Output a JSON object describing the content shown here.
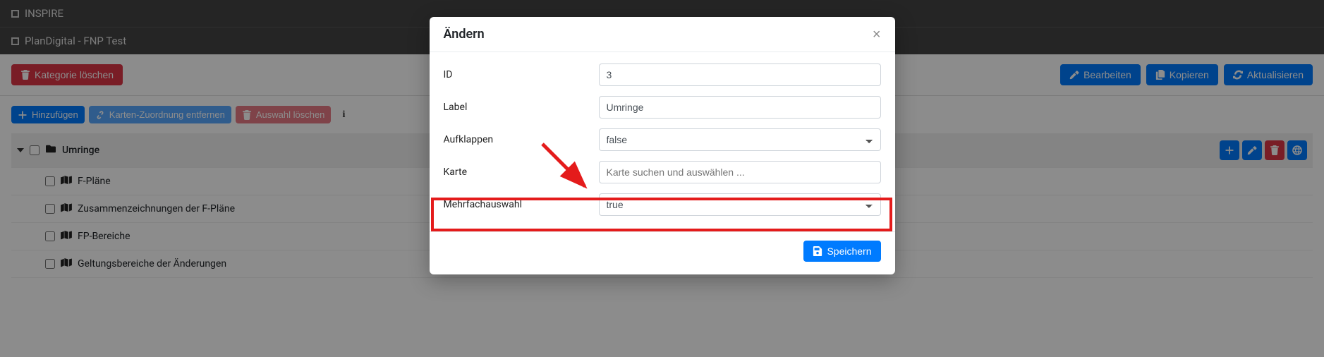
{
  "topbar": {
    "title1": "INSPIRE",
    "title2": "PlanDigital - FNP Test"
  },
  "toolbar": {
    "delete_category": "Kategorie löschen",
    "edit": "Bearbeiten",
    "copy": "Kopieren",
    "refresh": "Aktualisieren"
  },
  "subtoolbar": {
    "add": "Hinzufügen",
    "remove_map_assignment": "Karten-Zuordnung entfernen",
    "delete_selection": "Auswahl löschen"
  },
  "tree": {
    "root": {
      "label": "Umringe"
    },
    "children": [
      {
        "label": "F-Pläne"
      },
      {
        "label": "Zusammenzeichnungen der F-Pläne"
      },
      {
        "label": "FP-Bereiche"
      },
      {
        "label": "Geltungsbereiche der Änderungen"
      }
    ]
  },
  "modal": {
    "title": "Ändern",
    "fields": {
      "id": {
        "label": "ID",
        "value": "3"
      },
      "label": {
        "label": "Label",
        "value": "Umringe"
      },
      "aufklappen": {
        "label": "Aufklappen",
        "value": "false"
      },
      "karte": {
        "label": "Karte",
        "placeholder": "Karte suchen und auswählen ..."
      },
      "mehrfachauswahl": {
        "label": "Mehrfachauswahl",
        "value": "true"
      }
    },
    "save": "Speichern"
  }
}
